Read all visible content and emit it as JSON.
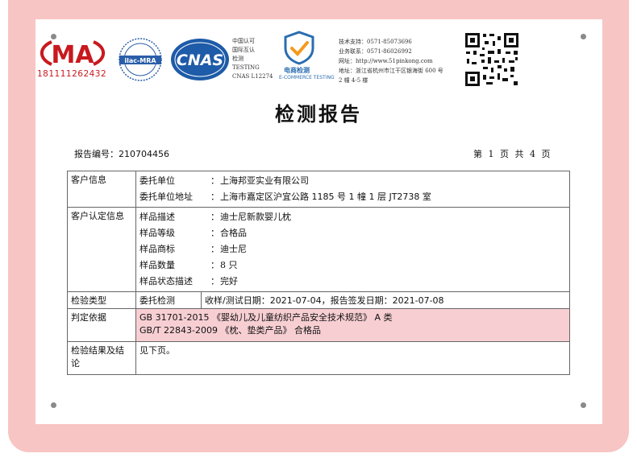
{
  "header": {
    "cma_text": "MA",
    "cma_number": "181111262432",
    "ilac_text": "ilac-MRA",
    "cnas_text": "CNAS",
    "cnas_lines": [
      "中国认可",
      "国际互认",
      "检测",
      "TESTING",
      "CNAS L12274"
    ],
    "shield_title": "电商检测",
    "shield_subtitle": "E-COMMERCE TESTING",
    "contact_lines": [
      "技术支持：0571-85073696",
      "业务联系：0571-86026992",
      "网址：http://www.51pinkong.com",
      "地址：浙江省杭州市江干区银海街 600 号",
      "2 幢 4-5 楼"
    ]
  },
  "document": {
    "title": "检测报告",
    "report_number_label": "报告编号：210704456",
    "page_info": "第 1 页 共 4 页"
  },
  "table": {
    "client": {
      "label": "客户信息",
      "rows": [
        {
          "key": "委托单位",
          "colon": "：",
          "value": "上海邦亚实业有限公司"
        },
        {
          "key": "委托单位地址",
          "colon": "：",
          "value": "上海市嘉定区沪宜公路 1185 号 1 幢 1 层 JT2738 室"
        }
      ]
    },
    "sample": {
      "label": "客户认定信息",
      "rows": [
        {
          "key": "样品描述",
          "colon": "：",
          "value": "迪士尼新款婴儿枕"
        },
        {
          "key": "样品等级",
          "colon": "：",
          "value": "合格品"
        },
        {
          "key": "样品商标",
          "colon": "：",
          "value": "迪士尼"
        },
        {
          "key": "样品数量",
          "colon": "：",
          "value": "8 只"
        },
        {
          "key": "样品状态描述",
          "colon": "：",
          "value": "完好"
        }
      ]
    },
    "inspection": {
      "label": "检验类型",
      "type": "委托检测",
      "dates": "收样/测试日期：2021-07-04，报告签发日期：2021-07-08"
    },
    "basis": {
      "label": "判定依据",
      "line1": "GB 31701-2015 《婴幼儿及儿童纺织产品安全技术规范》 A 类",
      "line2": "GB/T 22843-2009 《枕、垫类产品》 合格品"
    },
    "result": {
      "label": "检验结果及结论",
      "value": "见下页。"
    }
  }
}
